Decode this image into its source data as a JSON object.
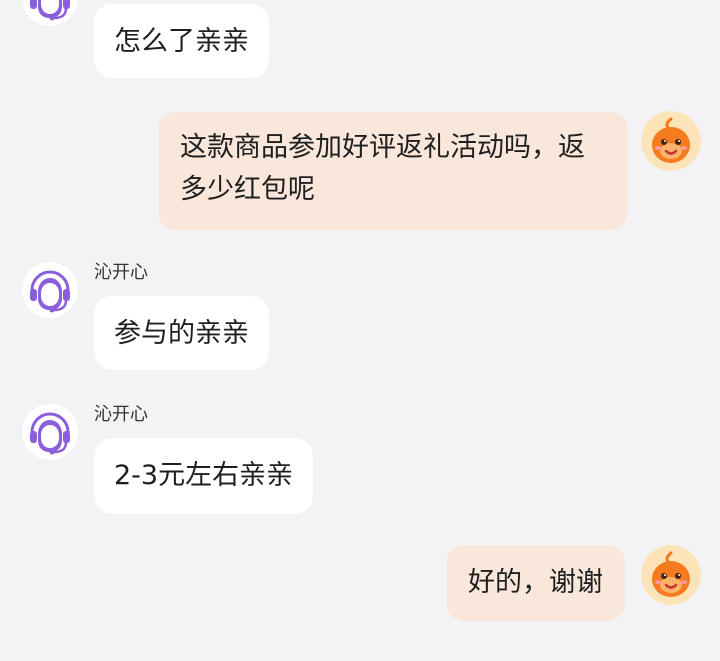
{
  "chat": {
    "messages": [
      {
        "sender": "agent",
        "name": "",
        "text": "怎么了亲亲"
      },
      {
        "sender": "user",
        "text": "这款商品参加好评返礼活动吗，返多少红包呢"
      },
      {
        "sender": "agent",
        "name": "沁开心",
        "text": "参与的亲亲"
      },
      {
        "sender": "agent",
        "name": "沁开心",
        "text": "2-3元左右亲亲"
      },
      {
        "sender": "user",
        "text": "好的，谢谢"
      }
    ]
  },
  "colors": {
    "background": "#f3f3f5",
    "agent_bubble": "#ffffff",
    "user_bubble": "#f8e7da",
    "agent_avatar_accent": "#8b5fdc",
    "user_avatar_accent": "#f57b1e"
  },
  "icons": {
    "agent": "customer-service-headset-icon",
    "user": "orange-mascot-icon"
  }
}
